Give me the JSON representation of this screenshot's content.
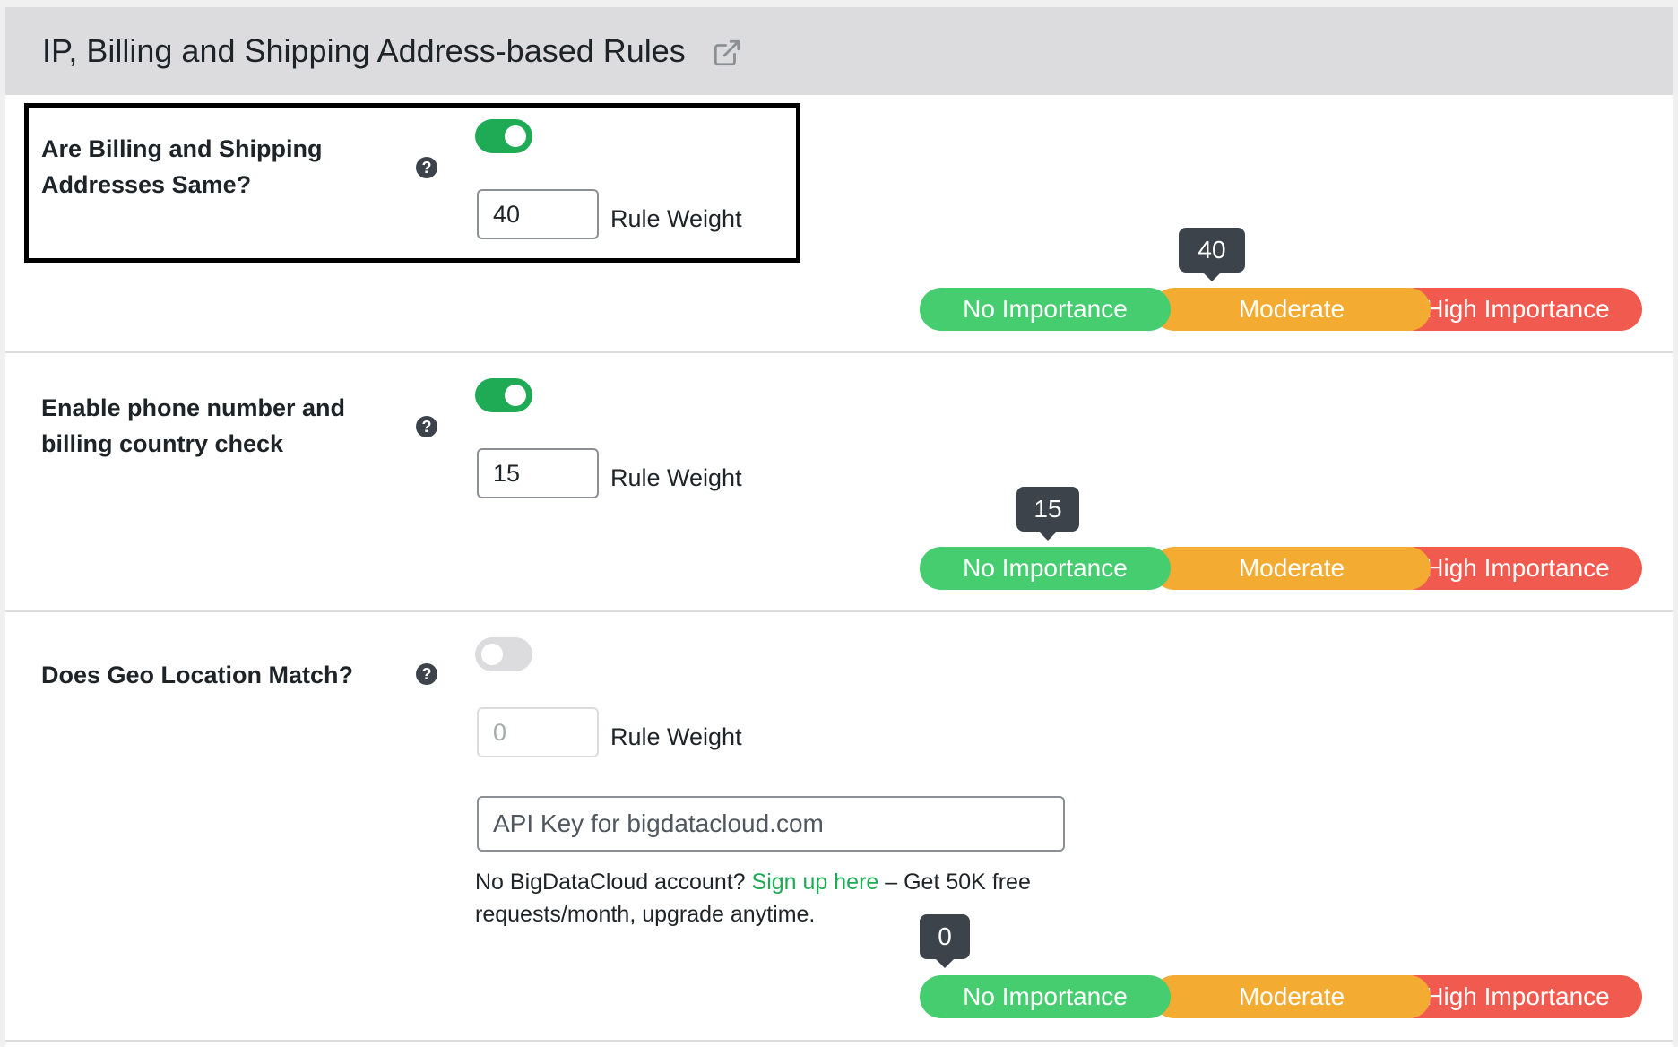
{
  "section": {
    "title": "IP, Billing and Shipping Address-based Rules",
    "external_icon": "external-link-icon"
  },
  "scale_labels": {
    "none": "No Importance",
    "moderate": "Moderate",
    "high": "High Importance"
  },
  "rules": [
    {
      "label_line1": "Are Billing and Shipping",
      "label_line2": "Addresses Same?",
      "enabled": true,
      "weight": "40",
      "weight_label": "Rule Weight",
      "tooltip": "40",
      "highlighted": true
    },
    {
      "label_line1": "Enable phone number and",
      "label_line2": "billing country check",
      "enabled": true,
      "weight": "15",
      "weight_label": "Rule Weight",
      "tooltip": "15"
    },
    {
      "label_line1": "Does Geo Location Match?",
      "enabled": false,
      "weight": "0",
      "weight_label": "Rule Weight",
      "tooltip": "0",
      "api_placeholder": "API Key for bigdatacloud.com",
      "note_prefix": "No BigDataCloud account?",
      "note_link": "Sign up here",
      "note_suffix": "– Get 50K free requests/month, upgrade anytime."
    }
  ],
  "help_glyph": "?",
  "colors": {
    "header_bg": "#dcdcde",
    "toggle_on": "#1fab55",
    "toggle_off": "#dcdcde",
    "no_importance": "#46cd6f",
    "moderate": "#f4ab31",
    "high_importance": "#f05a4f",
    "tooltip": "#3c434a",
    "link": "#1fab55"
  }
}
